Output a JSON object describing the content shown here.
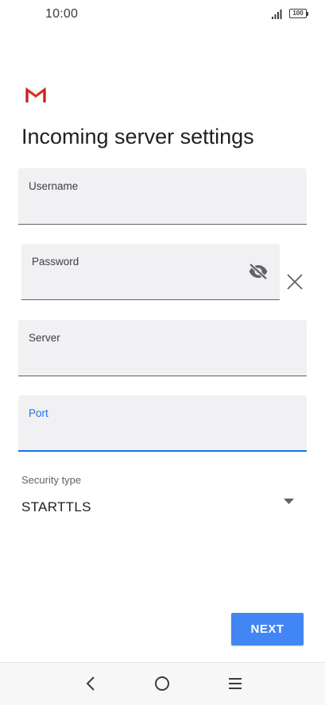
{
  "status_bar": {
    "time": "10:00",
    "battery": "100",
    "signal_icon": "signal-bars-icon",
    "battery_icon": "battery-icon"
  },
  "app": {
    "logo_icon": "gmail-logo-icon"
  },
  "page": {
    "title": "Incoming server settings"
  },
  "fields": {
    "username": {
      "label": "Username",
      "value": ""
    },
    "password": {
      "label": "Password",
      "value": "",
      "visibility_icon": "eye-off-icon",
      "clear_icon": "close-icon"
    },
    "server": {
      "label": "Server",
      "value": ""
    },
    "port": {
      "label": "Port",
      "value": "",
      "focused": true
    }
  },
  "security": {
    "label": "Security type",
    "selected": "STARTTLS",
    "dropdown_icon": "dropdown-arrow-icon"
  },
  "actions": {
    "next_label": "NEXT"
  },
  "navigation": {
    "back_icon": "back-icon",
    "home_icon": "home-icon",
    "menu_icon": "menu-icon"
  },
  "colors": {
    "accent": "#1a73e8",
    "button": "#4285f4",
    "field_bg": "#f1f1f3",
    "gmail_red": "#d93025"
  }
}
